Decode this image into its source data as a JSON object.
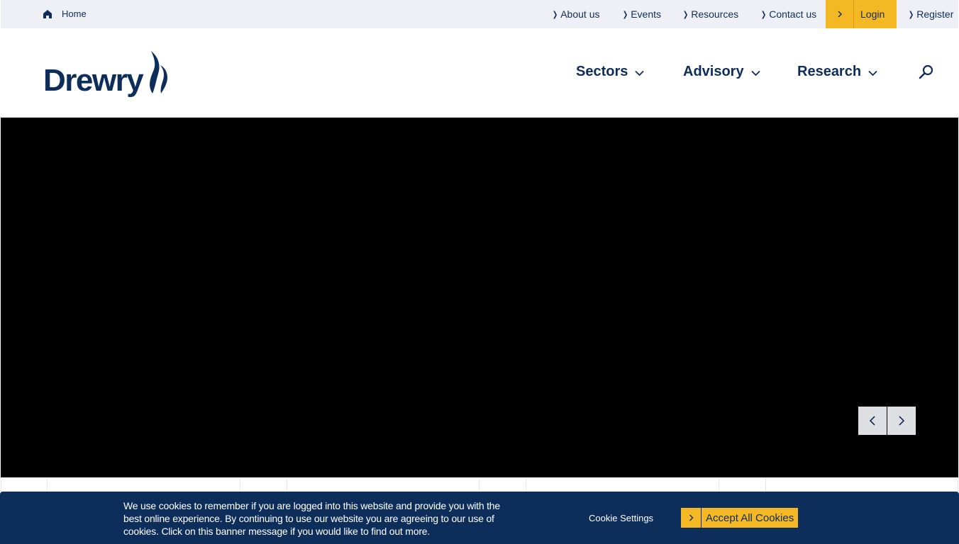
{
  "topbar": {
    "home_label": "Home",
    "links": [
      {
        "label": "About us"
      },
      {
        "label": "Events"
      },
      {
        "label": "Resources"
      },
      {
        "label": "Contact us"
      }
    ],
    "login_label": "Login",
    "register_label": "Register"
  },
  "header": {
    "logo_text": "Drewry",
    "nav": [
      {
        "label": "Sectors",
        "icon": "chevron-down-icon"
      },
      {
        "label": "Advisory",
        "icon": "chevron-down-icon"
      },
      {
        "label": "Research",
        "icon": "chevron-down-icon"
      }
    ],
    "search_icon": "search-icon"
  },
  "hero": {
    "prev_icon": "chevron-left-icon",
    "next_icon": "chevron-right-icon"
  },
  "cookie_banner": {
    "message": "We use cookies to remember if you are logged into this website and provide you with the best online experience. By continuing to use our website you are agreeing to our use of cookies. Click on this banner message if you would like to find out more.",
    "settings_label": "Cookie Settings",
    "accept_label": "Accept All Cookies"
  },
  "colors": {
    "brand_navy": "#0d2d5a",
    "accent_yellow": "#f5b825",
    "topbar_bg": "#eef0f5"
  }
}
